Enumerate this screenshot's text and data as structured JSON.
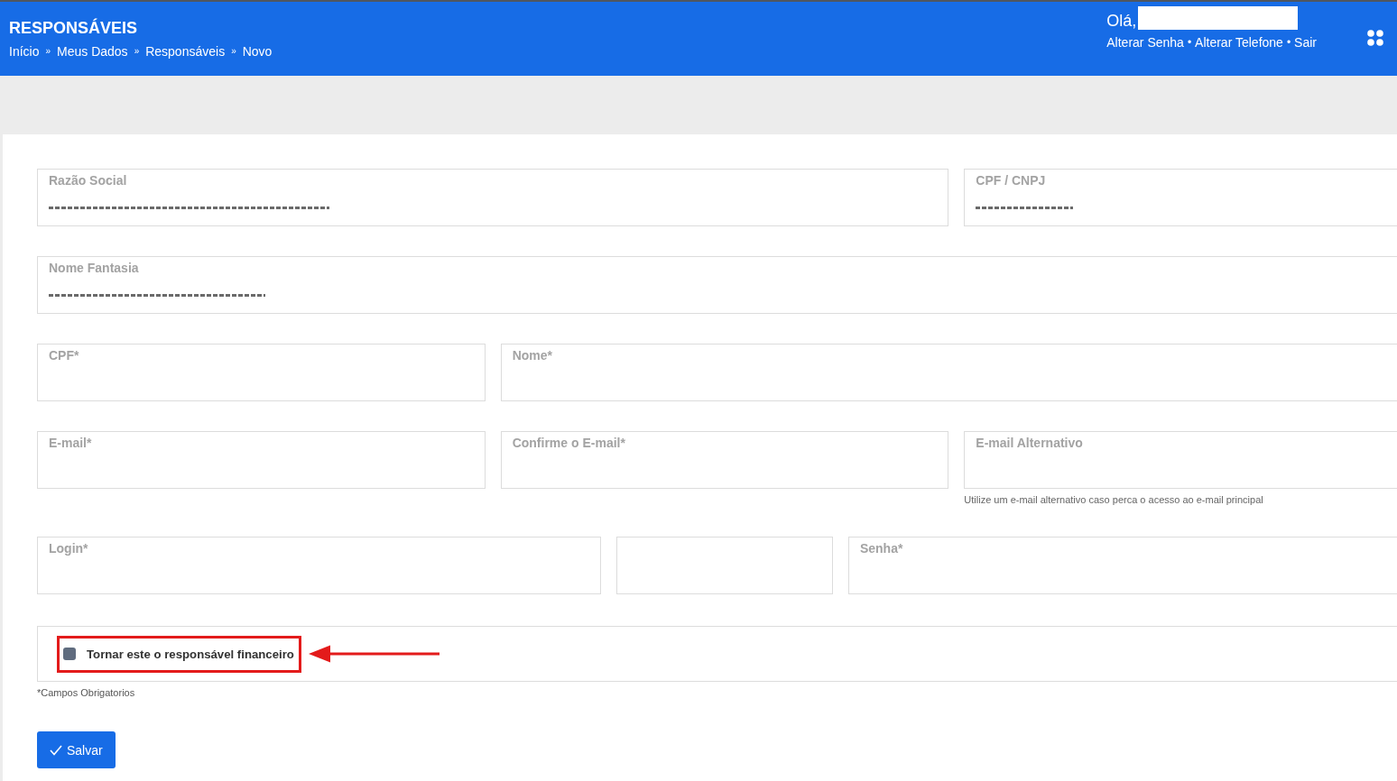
{
  "header": {
    "title": "RESPONSÁVEIS",
    "breadcrumb": [
      {
        "label": "Início"
      },
      {
        "separator": "»",
        "label": "Meus Dados"
      },
      {
        "separator": "»",
        "label": "Responsáveis"
      },
      {
        "separator": "»",
        "label": "Novo"
      }
    ],
    "greeting": "Olá,",
    "name_redacted": true,
    "links": [
      {
        "label": "Alterar Senha"
      },
      {
        "separator": "•",
        "label": "Alterar Telefone"
      },
      {
        "separator": "•",
        "label": "Sair"
      }
    ]
  },
  "form": {
    "rows": [
      [
        {
          "label": "Razão Social",
          "value_clipped": true
        },
        {
          "label": "CPF / CNPJ",
          "value_clipped": true
        }
      ],
      [
        {
          "label": "Nome Fantasia",
          "value_clipped": true
        }
      ],
      [
        {
          "label": "CPF*",
          "value_clipped": false
        },
        {
          "label": "Nome*",
          "value_clipped": false
        }
      ],
      [
        {
          "label": "E-mail*",
          "value_clipped": false
        },
        {
          "label": "Confirme o E-mail*",
          "value_clipped": false
        },
        {
          "label": "E-mail Alternativo",
          "value_clipped": false,
          "help": "Utilize um e-mail alternativo caso perca o acesso ao e-mail principal"
        }
      ],
      [
        {
          "label": "Login*",
          "value_clipped": false
        },
        {
          "value_clipped": false
        },
        {
          "label": "Senha*",
          "value_clipped": false
        }
      ]
    ],
    "checkbox": {
      "label": "Tornar este o responsável financeiro",
      "checked": false,
      "highlighted": true
    },
    "required_note": "*Campos Obrigatorios",
    "save_button": {
      "label": "Salvar"
    }
  }
}
